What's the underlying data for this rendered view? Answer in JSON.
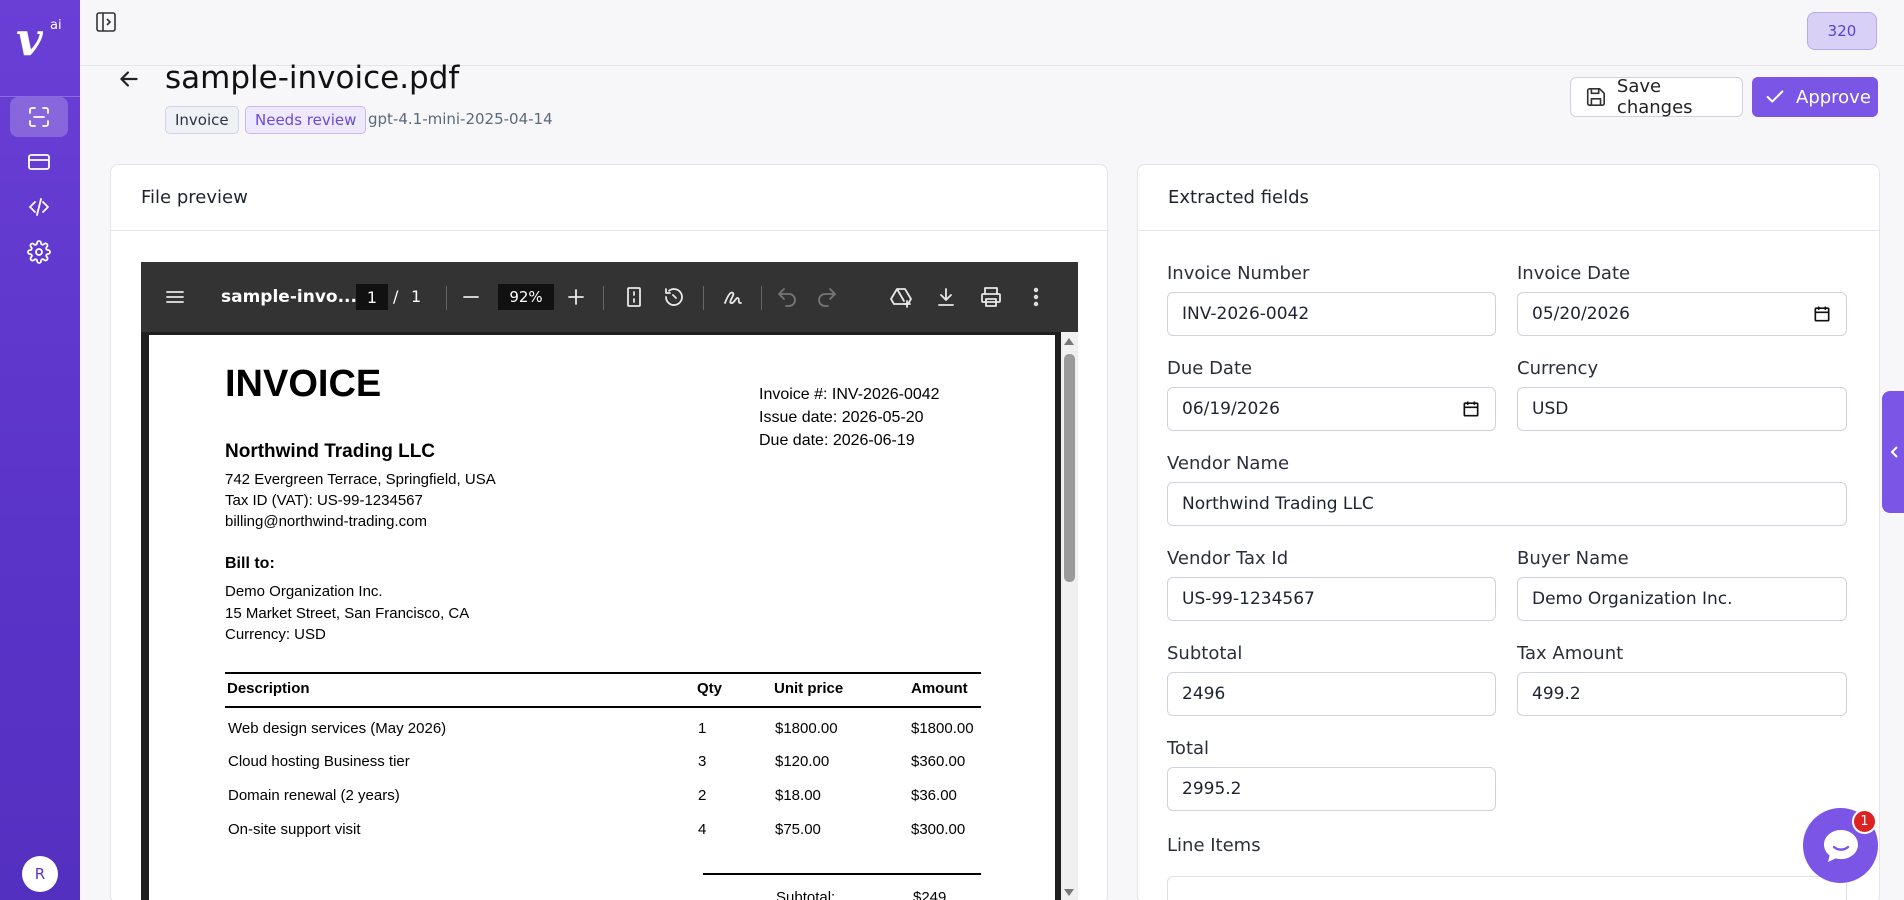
{
  "app": {
    "logo_letter": "v",
    "logo_suffix": "ai",
    "credits": "320",
    "user_initial": "R"
  },
  "header": {
    "title": "sample-invoice.pdf",
    "tags": {
      "type": "Invoice",
      "status": "Needs review"
    },
    "model": "gpt-4.1-mini-2025-04-14",
    "save_label": "Save changes",
    "approve_label": "Approve"
  },
  "preview": {
    "heading": "File preview",
    "viewer": {
      "filename": "sample-invo...",
      "page": "1",
      "separator": "/",
      "total_pages": "1",
      "zoom": "92%"
    },
    "document": {
      "title": "INVOICE",
      "meta": [
        "Invoice #: INV-2026-0042",
        "Issue date: 2026-05-20",
        "Due date: 2026-06-19"
      ],
      "vendor": "Northwind Trading LLC",
      "vendor_lines": [
        "742 Evergreen Terrace, Springfield, USA",
        "Tax ID (VAT): US-99-1234567",
        "billing@northwind-trading.com"
      ],
      "bill_to_heading": "Bill to:",
      "bill_to_lines": [
        "Demo Organization Inc.",
        "15 Market Street, San Francisco, CA",
        "Currency: USD"
      ],
      "table": {
        "headers": [
          "Description",
          "Qty",
          "Unit price",
          "Amount"
        ],
        "rows": [
          [
            "Web design services (May 2026)",
            "1",
            "$1800.00",
            "$1800.00"
          ],
          [
            "Cloud hosting   Business tier",
            "3",
            "$120.00",
            "$360.00"
          ],
          [
            "Domain renewal (2 years)",
            "2",
            "$18.00",
            "$36.00"
          ],
          [
            "On-site support visit",
            "4",
            "$75.00",
            "$300.00"
          ]
        ]
      },
      "subtotal_label": "Subtotal:",
      "subtotal_value": "$249"
    }
  },
  "fields": {
    "heading": "Extracted fields",
    "invoice_number": {
      "label": "Invoice Number",
      "value": "INV-2026-0042"
    },
    "invoice_date": {
      "label": "Invoice Date",
      "value": "05/20/2026"
    },
    "due_date": {
      "label": "Due Date",
      "value": "06/19/2026"
    },
    "currency": {
      "label": "Currency",
      "value": "USD"
    },
    "vendor_name": {
      "label": "Vendor Name",
      "value": "Northwind Trading LLC"
    },
    "vendor_tax_id": {
      "label": "Vendor Tax Id",
      "value": "US-99-1234567"
    },
    "buyer_name": {
      "label": "Buyer Name",
      "value": "Demo Organization Inc."
    },
    "subtotal": {
      "label": "Subtotal",
      "value": "2496"
    },
    "tax_amount": {
      "label": "Tax Amount",
      "value": "499.2"
    },
    "total": {
      "label": "Total",
      "value": "2995.2"
    },
    "line_items_label": "Line Items"
  },
  "chat": {
    "unread": "1"
  },
  "colors": {
    "brand": "#6a3fd6",
    "accent": "#7b55e6",
    "badge": "#d22222"
  }
}
